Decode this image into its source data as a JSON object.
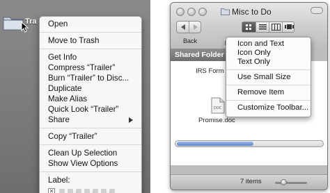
{
  "desktop": {
    "item_label": "Tra"
  },
  "context_menu": {
    "groups": [
      [
        "Open"
      ],
      [
        "Move to Trash"
      ],
      [
        "Get Info",
        "Compress “Trailer”",
        "Burn “Trailer” to Disc...",
        "Duplicate",
        "Make Alias",
        "Quick Look “Trailer”",
        "Share"
      ],
      [
        "Copy “Trailer”"
      ],
      [
        "Clean Up Selection",
        "Show View Options"
      ]
    ],
    "label_heading": "Label:",
    "label_none_glyph": "✕"
  },
  "finder": {
    "title": "Misc to Do",
    "back_label": "Back",
    "sidebar_heading": "Shared Folder",
    "files": [
      "IRS Form W",
      "Promise.doc"
    ],
    "doc_icon_text": "DOC",
    "status": "7 items"
  },
  "toolbar_menu": {
    "group1": [
      "Icon and Text",
      "Icon Only",
      "Text Only"
    ],
    "group2": [
      "Use Small Size"
    ],
    "group3": [
      "Remove Item"
    ],
    "group4": [
      "Customize Toolbar..."
    ]
  },
  "colors": {
    "desktop_bg": "#7a7a7a",
    "menu_bg": "#fafafa",
    "window_chrome": "#bdbdbd",
    "scroll_thumb": "#5a86cc"
  }
}
